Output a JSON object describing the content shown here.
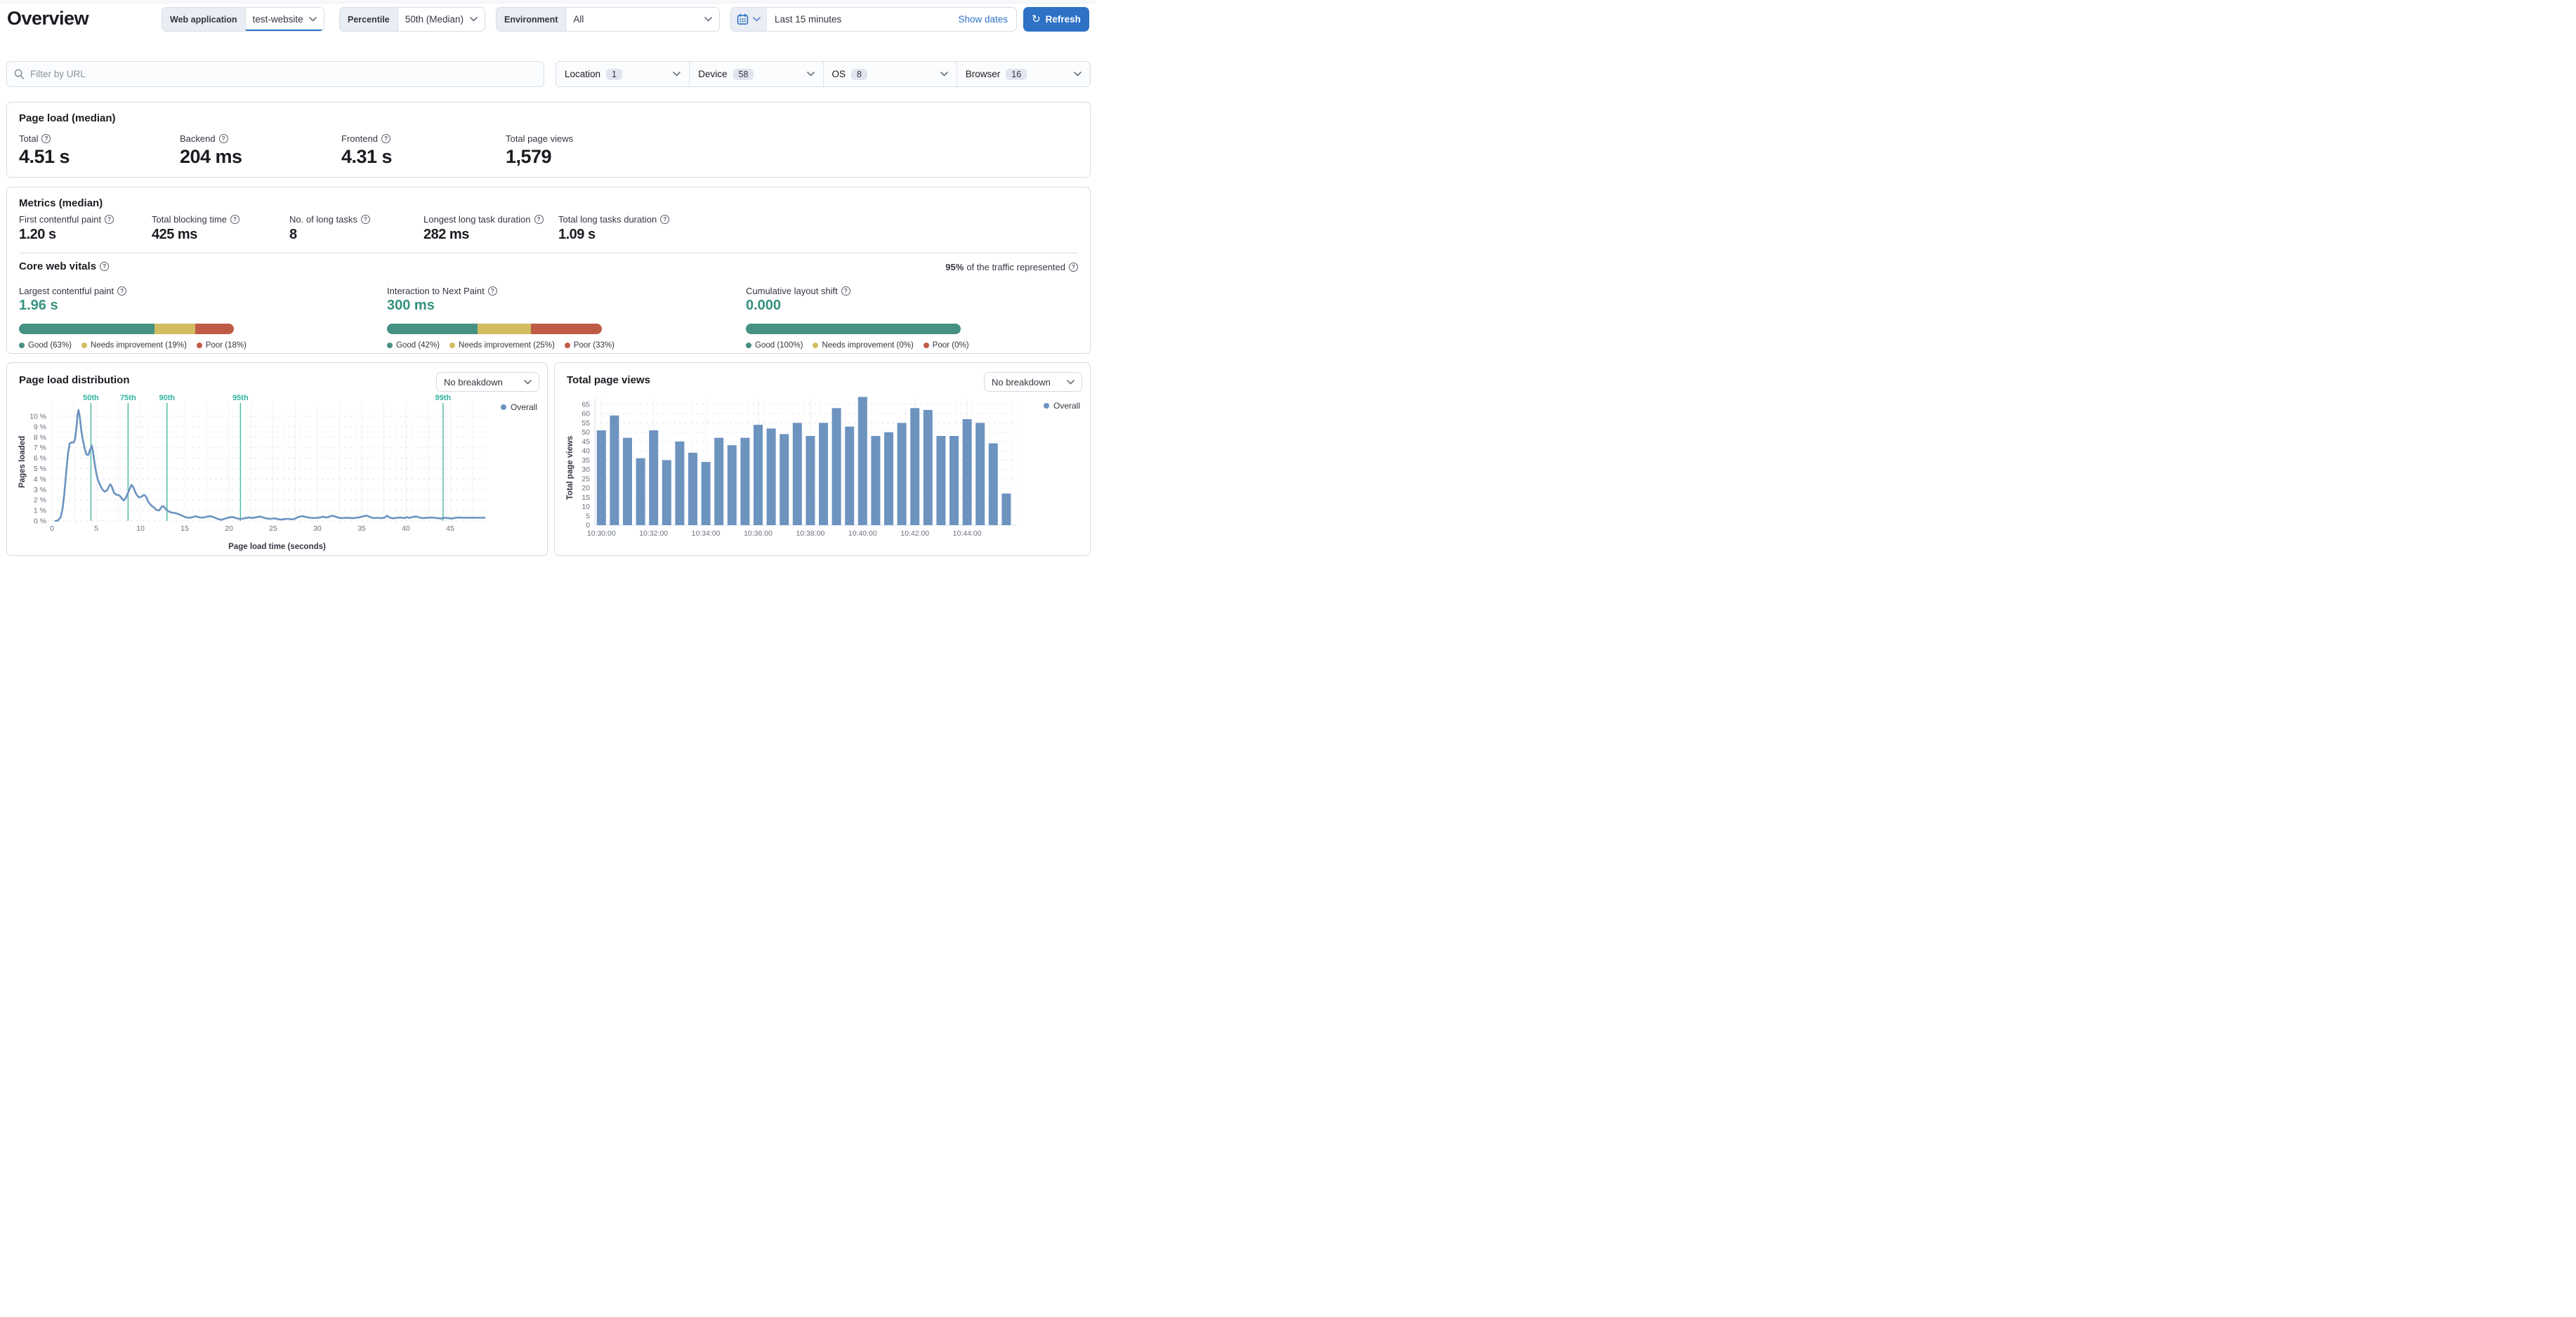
{
  "header": {
    "title": "Overview",
    "web_application": {
      "label": "Web application",
      "value": "test-website"
    },
    "percentile": {
      "label": "Percentile",
      "value": "50th (Median)"
    },
    "environment": {
      "label": "Environment",
      "value": "All"
    },
    "date_picker": {
      "value": "Last 15 minutes",
      "show_dates_label": "Show dates"
    },
    "refresh_label": "Refresh"
  },
  "filters": {
    "url_placeholder": "Filter by URL",
    "groups": [
      {
        "label": "Location",
        "count": "1"
      },
      {
        "label": "Device",
        "count": "58"
      },
      {
        "label": "OS",
        "count": "8"
      },
      {
        "label": "Browser",
        "count": "16"
      }
    ]
  },
  "page_load": {
    "title": "Page load (median)",
    "stats": [
      {
        "label": "Total",
        "value": "4.51 s"
      },
      {
        "label": "Backend",
        "value": "204 ms"
      },
      {
        "label": "Frontend",
        "value": "4.31 s"
      },
      {
        "label": "Total page views",
        "value": "1,579"
      }
    ]
  },
  "metrics": {
    "title": "Metrics (median)",
    "stats": [
      {
        "label": "First contentful paint",
        "value": "1.20 s"
      },
      {
        "label": "Total blocking time",
        "value": "425 ms"
      },
      {
        "label": "No. of long tasks",
        "value": "8"
      },
      {
        "label": "Longest long task duration",
        "value": "282 ms"
      },
      {
        "label": "Total long tasks duration",
        "value": "1.09 s"
      }
    ]
  },
  "core_web_vitals": {
    "title": "Core web vitals",
    "traffic_strong": "95%",
    "traffic_rest": "of the traffic represented",
    "colors": {
      "good": "#459182",
      "needs": "#d2bd61",
      "poor": "#bf5b47"
    },
    "vitals": [
      {
        "label": "Largest contentful paint",
        "value": "1.96 s",
        "good": 63,
        "needs": 19,
        "poor": 18,
        "legend": [
          "Good (63%)",
          "Needs improvement (19%)",
          "Poor (18%)"
        ]
      },
      {
        "label": "Interaction to Next Paint",
        "value": "300 ms",
        "good": 42,
        "needs": 25,
        "poor": 33,
        "legend": [
          "Good (42%)",
          "Needs improvement (25%)",
          "Poor (33%)"
        ]
      },
      {
        "label": "Cumulative layout shift",
        "value": "0.000",
        "good": 100,
        "needs": 0,
        "poor": 0,
        "legend": [
          "Good (100%)",
          "Needs improvement (0%)",
          "Poor (0%)"
        ]
      }
    ]
  },
  "panels": {
    "distribution": {
      "title": "Page load distribution",
      "breakdown": "No breakdown",
      "legend": "Overall",
      "xlabel": "Page load time (seconds)",
      "ylabel": "Pages loaded"
    },
    "page_views": {
      "title": "Total page views",
      "breakdown": "No breakdown",
      "legend": "Overall",
      "ylabel": "Total page views"
    }
  },
  "chart_data": [
    {
      "type": "line",
      "name": "page_load_distribution",
      "title": "Page load distribution",
      "xlabel": "Page load time (seconds)",
      "ylabel": "Pages loaded",
      "legend": [
        "Overall"
      ],
      "color": "#6b93c0",
      "grid": true,
      "xlim": [
        0,
        49
      ],
      "ylim": [
        0,
        10.8
      ],
      "xticks": [
        0,
        5,
        10,
        15,
        20,
        25,
        30,
        35,
        40,
        45
      ],
      "yticks": [
        0,
        1,
        2,
        3,
        4,
        5,
        6,
        7,
        8,
        9,
        10
      ],
      "ytick_suffix": " %",
      "percentiles": [
        {
          "label": "50th",
          "x": 4.4
        },
        {
          "label": "75th",
          "x": 8.6
        },
        {
          "label": "90th",
          "x": 13.0
        },
        {
          "label": "95th",
          "x": 21.3
        },
        {
          "label": "99th",
          "x": 44.2
        }
      ],
      "points": [
        [
          0.4,
          0
        ],
        [
          0.7,
          0.05
        ],
        [
          1.0,
          0.4
        ],
        [
          1.2,
          1.2
        ],
        [
          1.4,
          2.6
        ],
        [
          1.6,
          4.6
        ],
        [
          1.8,
          6.4
        ],
        [
          2.0,
          7.4
        ],
        [
          2.2,
          7.5
        ],
        [
          2.45,
          7.5
        ],
        [
          2.6,
          7.8
        ],
        [
          2.75,
          8.8
        ],
        [
          2.9,
          10.2
        ],
        [
          3.0,
          10.6
        ],
        [
          3.15,
          9.9
        ],
        [
          3.3,
          8.7
        ],
        [
          3.5,
          7.7
        ],
        [
          3.7,
          6.9
        ],
        [
          3.9,
          6.35
        ],
        [
          4.1,
          6.3
        ],
        [
          4.3,
          6.8
        ],
        [
          4.5,
          7.2
        ],
        [
          4.65,
          6.6
        ],
        [
          4.8,
          5.6
        ],
        [
          5.0,
          4.6
        ],
        [
          5.2,
          3.9
        ],
        [
          5.45,
          3.4
        ],
        [
          5.7,
          3.0
        ],
        [
          5.95,
          2.8
        ],
        [
          6.2,
          2.9
        ],
        [
          6.45,
          3.3
        ],
        [
          6.6,
          3.5
        ],
        [
          6.75,
          3.3
        ],
        [
          7.0,
          2.7
        ],
        [
          7.3,
          2.5
        ],
        [
          7.6,
          2.45
        ],
        [
          7.9,
          2.15
        ],
        [
          8.1,
          1.95
        ],
        [
          8.35,
          2.2
        ],
        [
          8.6,
          2.7
        ],
        [
          8.85,
          3.2
        ],
        [
          9.0,
          3.45
        ],
        [
          9.2,
          3.2
        ],
        [
          9.5,
          2.6
        ],
        [
          9.8,
          2.25
        ],
        [
          10.1,
          2.3
        ],
        [
          10.4,
          2.5
        ],
        [
          10.65,
          2.3
        ],
        [
          10.9,
          1.8
        ],
        [
          11.2,
          1.5
        ],
        [
          11.5,
          1.3
        ],
        [
          11.8,
          1.05
        ],
        [
          12.1,
          1.0
        ],
        [
          12.4,
          1.35
        ],
        [
          12.6,
          1.4
        ],
        [
          12.9,
          1.1
        ],
        [
          13.2,
          0.9
        ],
        [
          13.5,
          0.8
        ],
        [
          13.9,
          0.75
        ],
        [
          14.3,
          0.65
        ],
        [
          14.7,
          0.5
        ],
        [
          15.1,
          0.35
        ],
        [
          15.5,
          0.3
        ],
        [
          15.9,
          0.35
        ],
        [
          16.2,
          0.45
        ],
        [
          16.6,
          0.35
        ],
        [
          17.0,
          0.3
        ],
        [
          17.5,
          0.4
        ],
        [
          17.9,
          0.45
        ],
        [
          18.3,
          0.35
        ],
        [
          18.7,
          0.2
        ],
        [
          19.1,
          0.1
        ],
        [
          19.5,
          0.2
        ],
        [
          19.9,
          0.3
        ],
        [
          20.3,
          0.38
        ],
        [
          20.7,
          0.3
        ],
        [
          21.1,
          0.2
        ],
        [
          21.5,
          0.2
        ],
        [
          21.9,
          0.28
        ],
        [
          22.3,
          0.33
        ],
        [
          22.7,
          0.28
        ],
        [
          23.1,
          0.35
        ],
        [
          23.5,
          0.42
        ],
        [
          23.9,
          0.32
        ],
        [
          24.3,
          0.22
        ],
        [
          24.7,
          0.2
        ],
        [
          25.1,
          0.25
        ],
        [
          25.5,
          0.18
        ],
        [
          25.9,
          0.12
        ],
        [
          26.3,
          0.18
        ],
        [
          26.7,
          0.2
        ],
        [
          27.1,
          0.15
        ],
        [
          27.5,
          0.22
        ],
        [
          27.9,
          0.4
        ],
        [
          28.3,
          0.45
        ],
        [
          28.7,
          0.38
        ],
        [
          29.1,
          0.3
        ],
        [
          29.5,
          0.28
        ],
        [
          29.9,
          0.28
        ],
        [
          30.3,
          0.33
        ],
        [
          30.7,
          0.4
        ],
        [
          31.0,
          0.32
        ],
        [
          31.3,
          0.38
        ],
        [
          31.6,
          0.5
        ],
        [
          32.0,
          0.42
        ],
        [
          32.4,
          0.3
        ],
        [
          32.8,
          0.26
        ],
        [
          33.2,
          0.3
        ],
        [
          33.6,
          0.28
        ],
        [
          34.0,
          0.26
        ],
        [
          34.4,
          0.3
        ],
        [
          34.8,
          0.35
        ],
        [
          35.2,
          0.45
        ],
        [
          35.6,
          0.5
        ],
        [
          36.0,
          0.35
        ],
        [
          36.4,
          0.26
        ],
        [
          36.8,
          0.3
        ],
        [
          37.2,
          0.26
        ],
        [
          37.6,
          0.32
        ],
        [
          37.9,
          0.5
        ],
        [
          38.2,
          0.3
        ],
        [
          38.6,
          0.25
        ],
        [
          39.0,
          0.3
        ],
        [
          39.4,
          0.32
        ],
        [
          39.8,
          0.26
        ],
        [
          40.1,
          0.36
        ],
        [
          40.4,
          0.28
        ],
        [
          40.8,
          0.38
        ],
        [
          41.2,
          0.42
        ],
        [
          41.6,
          0.3
        ],
        [
          42.0,
          0.26
        ],
        [
          42.4,
          0.3
        ],
        [
          42.8,
          0.32
        ],
        [
          43.2,
          0.3
        ],
        [
          43.6,
          0.26
        ],
        [
          44.0,
          0.22
        ],
        [
          44.4,
          0.3
        ],
        [
          44.8,
          0.26
        ],
        [
          45.2,
          0.22
        ],
        [
          45.6,
          0.3
        ],
        [
          46.0,
          0.32
        ],
        [
          46.4,
          0.3
        ],
        [
          46.9,
          0.3
        ],
        [
          47.4,
          0.3
        ],
        [
          47.9,
          0.3
        ],
        [
          48.4,
          0.3
        ],
        [
          48.9,
          0.3
        ]
      ]
    },
    {
      "type": "bar",
      "name": "total_page_views",
      "title": "Total page views",
      "ylabel": "Total page views",
      "legend": [
        "Overall"
      ],
      "color": "#6d93bf",
      "grid": true,
      "ylim": [
        0,
        69
      ],
      "yticks": [
        0,
        5,
        10,
        15,
        20,
        25,
        30,
        35,
        40,
        45,
        50,
        55,
        60,
        65
      ],
      "categories": [
        "10:30:00",
        "10:30:30",
        "10:31:00",
        "10:31:30",
        "10:32:00",
        "10:32:30",
        "10:33:00",
        "10:33:30",
        "10:34:00",
        "10:34:30",
        "10:35:00",
        "10:35:30",
        "10:36:00",
        "10:36:30",
        "10:37:00",
        "10:37:30",
        "10:38:00",
        "10:38:30",
        "10:39:00",
        "10:39:30",
        "10:40:00",
        "10:40:30",
        "10:41:00",
        "10:41:30",
        "10:42:00",
        "10:42:30",
        "10:43:00",
        "10:43:30",
        "10:44:00",
        "10:44:30",
        "10:45:00",
        "10:45:30"
      ],
      "values": [
        51,
        59,
        47,
        36,
        51,
        35,
        45,
        39,
        34,
        47,
        43,
        47,
        54,
        52,
        49,
        55,
        48,
        55,
        63,
        53,
        69,
        48,
        50,
        55,
        63,
        62,
        48,
        48,
        57,
        55,
        44,
        17
      ],
      "xtick_positions": [
        0,
        4,
        8,
        12,
        16,
        20,
        24,
        28
      ],
      "xtick_labels": [
        "10:30:00",
        "10:32:00",
        "10:34:00",
        "10:36:00",
        "10:38:00",
        "10:40:00",
        "10:42:00",
        "10:44:00"
      ]
    }
  ]
}
